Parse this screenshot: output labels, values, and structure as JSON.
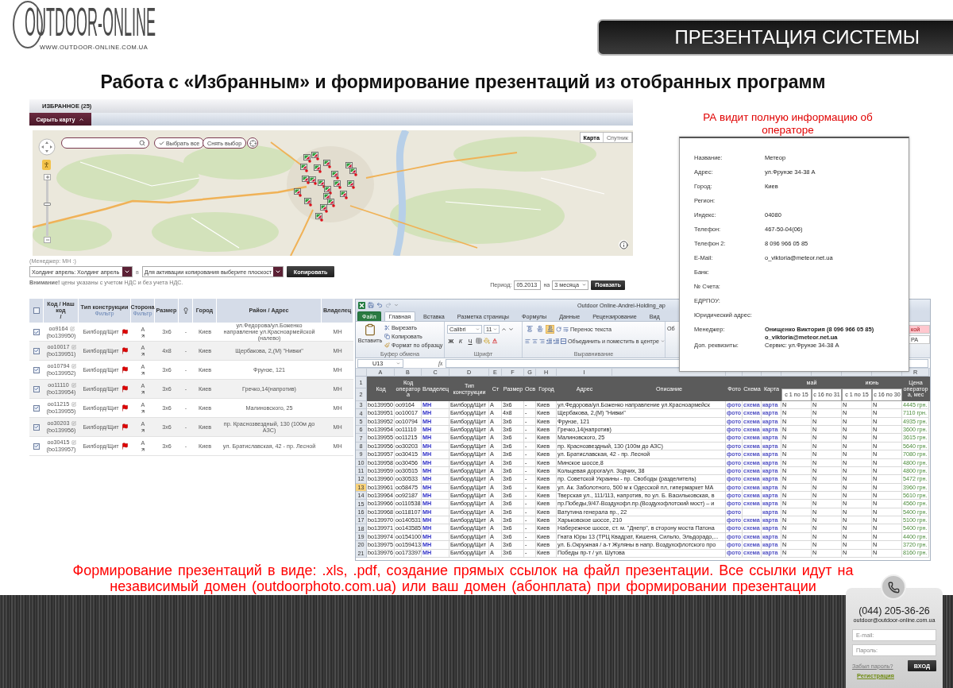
{
  "header": {
    "logo_name": "OUTDOOR-ONLINE",
    "logo_url": "WWW.OUTDOOR-ONLINE.COM.UA",
    "banner": "ПРЕЗЕНТАЦИЯ СИСТЕМЫ"
  },
  "title": "Работа с «Избранным» и формирование презентаций из отобранных программ",
  "favorites_panel": {
    "heading": "ИЗБРАННОЕ (25)",
    "toggle_button": "Скрыть карту",
    "map": {
      "select_all_button": "Выбрать все",
      "clear_button": "Снять выбор",
      "zoom": {
        "level": 0.58
      },
      "map_types": [
        {
          "label": "Карта",
          "selected": true
        },
        {
          "label": "Спутник",
          "selected": false
        }
      ]
    }
  },
  "copy_controls": {
    "manager_note": "(Менеджер: МН :)",
    "holding_select": "Холдинг апрель: Холдинг апрель",
    "in_label": "в",
    "target_select": "Для активации копирования выберите плоскост",
    "copy_button": "Копировать",
    "note": "**Внимание!** цены указаны с учетом НДС и без учета НДС."
  },
  "period": {
    "label": "Период:",
    "from": "05.2013",
    "on_label": "на",
    "duration": "3 месяца",
    "show_button": "Показать"
  },
  "operator_caption": "РА видит полную информацию об операторе",
  "favorites_table": {
    "columns": [
      {
        "kind": "checkbox",
        "checked": false
      },
      {
        "kind": "text",
        "label": "Код / Наш код",
        "sublabel": "/"
      },
      {
        "kind": "text",
        "label": "Тип конструкции",
        "filter": "Фильтр"
      },
      {
        "kind": "text",
        "label": "Сторона",
        "filter": "Фильтр"
      },
      {
        "kind": "text",
        "label": "Размер"
      },
      {
        "kind": "icon"
      },
      {
        "kind": "text",
        "label": "Город"
      },
      {
        "kind": "text",
        "label": "Район / Адрес"
      },
      {
        "kind": "text",
        "label": "Владелец"
      }
    ],
    "rows": [
      {
        "checked": true,
        "code": "oo9164",
        "code_alt": "(bo139950)",
        "type": "Билборд/Щит",
        "side": "А",
        "size": "3x6",
        "light": "-",
        "city": "Киев",
        "address": "ул.Федорова/ул.Боженко направление ул.Красноармейской (налево)",
        "owner": "МН"
      },
      {
        "checked": true,
        "code": "oo10017",
        "code_alt": "(bo139951)",
        "type": "Билборд/Щит",
        "side": "А",
        "size": "4x8",
        "light": "-",
        "city": "Киев",
        "address": "Щербакова, 2,(М) \"Нивки\"",
        "owner": "МН"
      },
      {
        "checked": true,
        "code": "oo10794",
        "code_alt": "(bo139952)",
        "type": "Билборд/Щит",
        "side": "А",
        "size": "3x6",
        "light": "-",
        "city": "Киев",
        "address": "Фрунзе, 121",
        "owner": "МН"
      },
      {
        "checked": true,
        "code": "oo11110",
        "code_alt": "(bo139954)",
        "type": "Билборд/Щит",
        "side": "А",
        "size": "3x6",
        "light": "-",
        "city": "Киев",
        "address": "Гречко,14(напротив)",
        "owner": "МН"
      },
      {
        "checked": true,
        "code": "oo11215",
        "code_alt": "(bo139955)",
        "type": "Билборд/Щит",
        "side": "А",
        "size": "3x6",
        "light": "-",
        "city": "Киев",
        "address": "Малиновского, 25",
        "owner": "МН"
      },
      {
        "checked": true,
        "code": "oo30203",
        "code_alt": "(bo139956)",
        "type": "Билборд/Щит",
        "side": "А",
        "size": "3x6",
        "light": "-",
        "city": "Киев",
        "address": "пр. Краснозвездный, 130 (100м до АЗС)",
        "owner": "МН"
      },
      {
        "checked": true,
        "code": "oo30415",
        "code_alt": "(bo139957)",
        "type": "Билборд/Щит",
        "side": "А",
        "size": "3x6",
        "light": "-",
        "city": "Киев",
        "address": "ул. Братиславская, 42 - пр. Лесной",
        "owner": "МН"
      }
    ]
  },
  "excel": {
    "title": "Outdoor Online-Andrei-Holding_ap",
    "tabs": [
      {
        "label": "Файл",
        "kind": "file",
        "selected": false
      },
      {
        "label": "Главная",
        "kind": "tab",
        "selected": true
      },
      {
        "label": "Вставка",
        "kind": "tab",
        "selected": false
      },
      {
        "label": "Разметка страницы",
        "kind": "tab",
        "selected": false
      },
      {
        "label": "Формулы",
        "kind": "tab",
        "selected": false
      },
      {
        "label": "Данные",
        "kind": "tab",
        "selected": false
      },
      {
        "label": "Рецензирование",
        "kind": "tab",
        "selected": false
      },
      {
        "label": "Вид",
        "kind": "tab",
        "selected": false
      }
    ],
    "clipboard": {
      "paste": "Вставить",
      "cut": "Вырезать",
      "copy": "Копировать",
      "format_painter": "Формат по образцу",
      "label": "Буфер обмена"
    },
    "font": {
      "name": "Calibri",
      "size": "11",
      "bold": "Ж",
      "italic": "К",
      "underline": "Ч",
      "label": "Шрифт"
    },
    "alignment": {
      "vertical": [
        {
          "selected": false
        },
        {
          "selected": false
        },
        {
          "selected": true
        }
      ],
      "wrap": "Перенос текста",
      "merge": "Объединить и поместить в центре",
      "label": "Выравнивание"
    },
    "number_fragment": "Об",
    "style_fragments": [
      "кой",
      "РА"
    ],
    "name_box": "U13",
    "formula_label": "fx",
    "columns": [
      {
        "letter": "A",
        "header": "Код",
        "kind": "text"
      },
      {
        "letter": "B",
        "header": "Код оператора",
        "kind": "text"
      },
      {
        "letter": "C",
        "header": "Владелец",
        "kind": "text"
      },
      {
        "letter": "D",
        "header": "Тип конструкции",
        "kind": "text"
      },
      {
        "letter": "E",
        "header": "Ст",
        "kind": "text"
      },
      {
        "letter": "F",
        "header": "Размер",
        "kind": "text"
      },
      {
        "letter": "G",
        "header": "Осв",
        "kind": "text"
      },
      {
        "letter": "H",
        "header": "Город",
        "kind": "text"
      },
      {
        "letter": "I",
        "header": "Адрес",
        "kind": "text"
      },
      {
        "header": "Описание",
        "kind": "text"
      },
      {
        "header": "Фото",
        "kind": "text"
      },
      {
        "header": "Схема",
        "kind": "text"
      },
      {
        "header": "Карта",
        "kind": "text"
      },
      {
        "header": "с 1 по 15",
        "kind": "period"
      },
      {
        "header": "с 16 по 31",
        "kind": "period"
      },
      {
        "header": "с 1 по 15",
        "kind": "period"
      },
      {
        "header": "с 16 по 30",
        "kind": "period"
      },
      {
        "letter": "R",
        "header": "Цена оператора, мес",
        "kind": "text"
      }
    ],
    "month_groups": [
      {
        "label": "май"
      },
      {
        "label": "июнь"
      }
    ],
    "header_row_numbers": [
      "1",
      "2"
    ],
    "rows": [
      {
        "number": "3",
        "selected": false,
        "code": "bo139950",
        "operator_code": "oo9164",
        "owner": "МН",
        "type": "Билборд/Щит",
        "side": "A",
        "size": "3x6",
        "light": "-",
        "city": "Киев",
        "address": "ул.Федорова/ул.Боженко направление ул.Красноармейск",
        "photo": "фото",
        "scheme": "схема",
        "map": "карта",
        "periods": [
          "N",
          "N",
          "N",
          "N"
        ],
        "price": "4445 грн."
      },
      {
        "number": "4",
        "selected": false,
        "code": "bo139951",
        "operator_code": "oo10017",
        "owner": "МН",
        "type": "Билборд/Щит",
        "side": "A",
        "size": "4x8",
        "light": "-",
        "city": "Киев",
        "address": "Щербакова, 2,(М) \"Нивки\"",
        "photo": "фото",
        "scheme": "схема",
        "map": "карта",
        "periods": [
          "N",
          "N",
          "N",
          "N"
        ],
        "price": "7110 грн."
      },
      {
        "number": "5",
        "selected": false,
        "code": "bo139952",
        "operator_code": "oo10794",
        "owner": "МН",
        "type": "Билборд/Щит",
        "side": "A",
        "size": "3x6",
        "light": "-",
        "city": "Киев",
        "address": "Фрунзе, 121",
        "photo": "фото",
        "scheme": "схема",
        "map": "карта",
        "periods": [
          "N",
          "N",
          "N",
          "N"
        ],
        "price": "4935 грн."
      },
      {
        "number": "6",
        "selected": false,
        "code": "bo139954",
        "operator_code": "oo11110",
        "owner": "МН",
        "type": "Билборд/Щит",
        "side": "A",
        "size": "3x6",
        "light": "-",
        "city": "Киев",
        "address": "Гречко,14(напротив)",
        "photo": "фото",
        "scheme": "схема",
        "map": "карта",
        "periods": [
          "N",
          "N",
          "N",
          "N"
        ],
        "price": "3600 грн."
      },
      {
        "number": "7",
        "selected": false,
        "code": "bo139955",
        "operator_code": "oo11215",
        "owner": "МН",
        "type": "Билборд/Щит",
        "side": "A",
        "size": "3x6",
        "light": "-",
        "city": "Киев",
        "address": "Малиновского, 25",
        "photo": "фото",
        "scheme": "схема",
        "map": "карта",
        "periods": [
          "N",
          "N",
          "N",
          "N"
        ],
        "price": "3615 грн."
      },
      {
        "number": "8",
        "selected": false,
        "code": "bo139956",
        "operator_code": "oo30203",
        "owner": "МН",
        "type": "Билборд/Щит",
        "side": "A",
        "size": "3x6",
        "light": "-",
        "city": "Киев",
        "address": "пр. Краснозвездный, 130 (100м до АЗС)",
        "photo": "фото",
        "scheme": "схема",
        "map": "карта",
        "periods": [
          "N",
          "N",
          "N",
          "N"
        ],
        "price": "5640 грн."
      },
      {
        "number": "9",
        "selected": false,
        "code": "bo139957",
        "operator_code": "oo30415",
        "owner": "МН",
        "type": "Билборд/Щит",
        "side": "A",
        "size": "3x6",
        "light": "-",
        "city": "Киев",
        "address": "ул. Братиславская, 42 - пр. Лесной",
        "photo": "фото",
        "scheme": "схема",
        "map": "карта",
        "periods": [
          "N",
          "N",
          "N",
          "N"
        ],
        "price": "7080 грн."
      },
      {
        "number": "10",
        "selected": false,
        "code": "bo139958",
        "operator_code": "oo30456",
        "owner": "МН",
        "type": "Билборд/Щит",
        "side": "A",
        "size": "3x6",
        "light": "-",
        "city": "Киев",
        "address": "Минское шоссе,8",
        "photo": "фото",
        "scheme": "схема",
        "map": "карта",
        "periods": [
          "N",
          "N",
          "N",
          "N"
        ],
        "price": "4800 грн."
      },
      {
        "number": "11",
        "selected": false,
        "code": "bo139959",
        "operator_code": "oo30515",
        "owner": "МН",
        "type": "Билборд/Щит",
        "side": "A",
        "size": "3x6",
        "light": "-",
        "city": "Киев",
        "address": "Кольцевая дорога/ул. Зодчих, 38",
        "photo": "фото",
        "scheme": "схема",
        "map": "карта",
        "periods": [
          "N",
          "N",
          "N",
          "N"
        ],
        "price": "4800 грн."
      },
      {
        "number": "12",
        "selected": false,
        "code": "bo139960",
        "operator_code": "oo30533",
        "owner": "МН",
        "type": "Билборд/Щит",
        "side": "A",
        "size": "3x6",
        "light": "-",
        "city": "Киев",
        "address": "пр. Советской Украины - пр. Свободы (разделитель)",
        "photo": "фото",
        "scheme": "схема",
        "map": "карта",
        "periods": [
          "N",
          "N",
          "N",
          "N"
        ],
        "price": "5472 грн."
      },
      {
        "number": "13",
        "selected": true,
        "code": "bo139961",
        "operator_code": "oo58475",
        "owner": "МН",
        "type": "Билборд/Щит",
        "side": "A",
        "size": "3x6",
        "light": "-",
        "city": "Киев",
        "address": "ул. Ак. Заболотного, 500 м к Одесской пл, гипермаркет МА",
        "photo": "фото",
        "scheme": "схема",
        "map": "карта",
        "periods": [
          "N",
          "N",
          "N",
          "N"
        ],
        "price": "3960 грн."
      },
      {
        "number": "14",
        "selected": false,
        "code": "bo139964",
        "operator_code": "oo92187",
        "owner": "МН",
        "type": "Билборд/Щит",
        "side": "A",
        "size": "3x6",
        "light": "-",
        "city": "Киев",
        "address": "Тверская ул., 111/113, напротив, по ул. Б. Васильковская, в",
        "photo": "фото",
        "scheme": "схема",
        "map": "карта",
        "periods": [
          "N",
          "N",
          "N",
          "N"
        ],
        "price": "5610 грн."
      },
      {
        "number": "15",
        "selected": false,
        "code": "bo139966",
        "operator_code": "oo110538",
        "owner": "МН",
        "type": "Билборд/Щит",
        "side": "A",
        "size": "3x6",
        "light": "-",
        "city": "Киев",
        "address": "пр.Победы,9/47-Воздухофл.пр.(Воздухофлотский мост) – и",
        "photo": "фото",
        "scheme": "схема",
        "map": "карта",
        "periods": [
          "N",
          "N",
          "N",
          "N"
        ],
        "price": "4560 грн."
      },
      {
        "number": "16",
        "selected": false,
        "code": "bo139968",
        "operator_code": "oo118107",
        "owner": "МН",
        "type": "Билборд/Щит",
        "side": "A",
        "size": "3x6",
        "light": "-",
        "city": "Киев",
        "address": "Ватутина генерала пр., 22",
        "photo": "фото",
        "map": "карта",
        "periods": [
          "N",
          "N",
          "N",
          "N"
        ],
        "price": "5400 грн."
      },
      {
        "number": "17",
        "selected": false,
        "code": "bo139970",
        "operator_code": "oo140531",
        "owner": "МН",
        "type": "Билборд/Щит",
        "side": "A",
        "size": "3x6",
        "light": "-",
        "city": "Киев",
        "address": "Харьковское шоссе, 210",
        "photo": "фото",
        "scheme": "схема",
        "map": "карта",
        "periods": [
          "N",
          "N",
          "N",
          "N"
        ],
        "price": "5100 грн."
      },
      {
        "number": "18",
        "selected": false,
        "code": "bo139971",
        "operator_code": "oo143585",
        "owner": "МН",
        "type": "Билборд/Щит",
        "side": "A",
        "size": "3x6",
        "light": "-",
        "city": "Киев",
        "address": "Набережное шоссе, ст. м. \"Днепр\", в сторону моста Патона",
        "photo": "фото",
        "scheme": "схема",
        "map": "карта",
        "periods": [
          "N",
          "N",
          "N",
          "N"
        ],
        "price": "5400 грн."
      },
      {
        "number": "19",
        "selected": false,
        "code": "bo139974",
        "operator_code": "oo154100",
        "owner": "МН",
        "type": "Билборд/Щит",
        "side": "A",
        "size": "3x6",
        "light": "-",
        "city": "Киев",
        "address": "Гната Юры 13 (ТРЦ Квадрат, Кишеня, Сильпо, Эльдорадо,...",
        "photo": "фото",
        "scheme": "схема",
        "map": "карта",
        "periods": [
          "N",
          "N",
          "N",
          "N"
        ],
        "price": "4400 грн."
      },
      {
        "number": "20",
        "selected": false,
        "code": "bo139975",
        "operator_code": "oo159413",
        "owner": "МН",
        "type": "Билборд/Щит",
        "side": "A",
        "size": "3x6",
        "light": "-",
        "city": "Киев",
        "address": "ул. Б.Окружная / а-т Жуляны в напр. Воздухофлотского про",
        "photo": "фото",
        "scheme": "схема",
        "map": "карта",
        "periods": [
          "N",
          "N",
          "N",
          "N"
        ],
        "price": "3720 грн."
      },
      {
        "number": "21",
        "selected": false,
        "code": "bo139976",
        "operator_code": "oo173397",
        "owner": "МН",
        "type": "Билборд/Щит",
        "side": "A",
        "size": "3x6",
        "light": "-",
        "city": "Киев",
        "address": "Победы пр-т / ул. Шутова",
        "photo": "фото",
        "scheme": "схема",
        "map": "карта",
        "periods": [
          "N",
          "N",
          "N",
          "N"
        ],
        "price": "8160 грн."
      }
    ]
  },
  "operator_info": {
    "fields": [
      {
        "label": "Название:",
        "values": [
          "Метеор"
        ],
        "bold": false
      },
      {
        "label": "Адрес:",
        "values": [
          "ул.Фрунзе 34-38 А"
        ],
        "bold": false
      },
      {
        "label": "Город:",
        "values": [
          "Киев"
        ],
        "bold": false
      },
      {
        "label": "Регион:"
      },
      {
        "label": "Индекс:",
        "values": [
          "04080"
        ],
        "bold": false
      },
      {
        "label": "Телефон:",
        "values": [
          "467-50-04(06)"
        ],
        "bold": false
      },
      {
        "label": "Телефон 2:",
        "values": [
          "8 096 966 05 85"
        ],
        "bold": false
      },
      {
        "label": "E-Mail:",
        "values": [
          "o_viktoria@meteor.net.ua"
        ],
        "bold": false
      },
      {
        "label": "Банк:"
      },
      {
        "label": "№ Счета:"
      },
      {
        "label": "ЕДРПОУ:"
      },
      {
        "label": "Юридический адрес:"
      },
      {
        "label": "Менеджер:",
        "values": [
          "Онищенко Виктория (8 096 966 05 85)",
          "o_viktoria@meteor.net.ua"
        ],
        "bold": true
      },
      {
        "label": "Доп. реквизиты:",
        "values": [
          "Сервис: ул.Фрунзе 34-38 А"
        ],
        "bold": false
      }
    ]
  },
  "footer_note": "Формирование презентаций в виде: .xls, .pdf, создание прямых ссылок на файл презентации. Все ссылки идут на независимый домен (outdoorphoto.com.ua) или ваш домен (абонплата) при формировании презентации",
  "login": {
    "phone": "(044) 205-36-26",
    "email": "outdoor@outdoor-online.com.ua",
    "email_placeholder": "E-mail:",
    "password_placeholder": "Пароль:",
    "forgot_link": "Забыл пароль?",
    "login_button": "ВХОД",
    "register_link": "Регистрация"
  }
}
